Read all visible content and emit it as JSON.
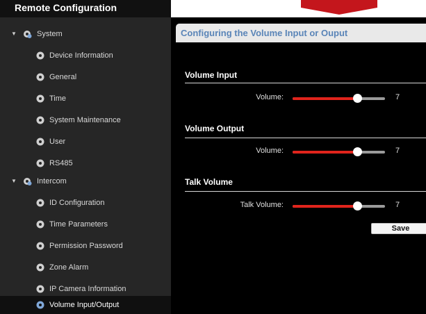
{
  "window": {
    "title": "Remote Configuration"
  },
  "sidebar": {
    "groups": [
      {
        "label": "System",
        "expanded": true,
        "items": [
          {
            "label": "Device Information"
          },
          {
            "label": "General"
          },
          {
            "label": "Time"
          },
          {
            "label": "System Maintenance"
          },
          {
            "label": "User"
          },
          {
            "label": "RS485"
          }
        ]
      },
      {
        "label": "Intercom",
        "expanded": true,
        "items": [
          {
            "label": "ID Configuration"
          },
          {
            "label": "Time Parameters"
          },
          {
            "label": "Permission Password"
          },
          {
            "label": "Zone Alarm"
          },
          {
            "label": "IP Camera Information"
          },
          {
            "label": "Volume Input/Output",
            "selected": true
          }
        ]
      }
    ]
  },
  "main": {
    "header": "Configuring the Volume Input or Ouput",
    "sections": [
      {
        "title": "Volume Input",
        "field_label": "Volume:",
        "value": "7",
        "level_fraction": 0.7
      },
      {
        "title": "Volume Output",
        "field_label": "Volume:",
        "value": "7",
        "level_fraction": 0.7
      },
      {
        "title": "Talk Volume",
        "field_label": "Talk Volume:",
        "value": "7",
        "level_fraction": 0.7
      }
    ],
    "save_label": "Save"
  },
  "colors": {
    "accent_red": "#e0241c",
    "header_text": "#5a85b8",
    "sidebar_bg": "#262626"
  },
  "icons": {
    "tree_node": "gear-icon",
    "group_node": "gears-icon",
    "expander": "triangle-down-icon"
  }
}
